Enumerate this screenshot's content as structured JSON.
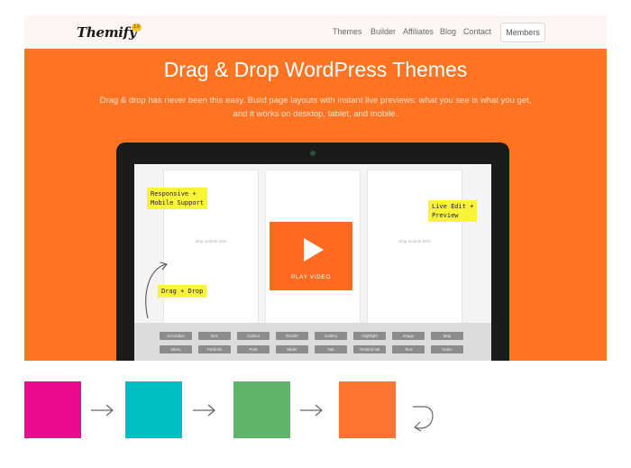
{
  "header": {
    "logo": "Themify",
    "logo_badge": "2.0",
    "nav": [
      "Themes",
      "Builder",
      "Affiliates",
      "Blog",
      "Contact"
    ],
    "members_label": "Members"
  },
  "hero": {
    "title": "Drag & Drop WordPress Themes",
    "subtitle": "Drag & drop has never been this easy. Build page layouts with instant live previews: what you see is what you get, and it works on desktop, tablet, and mobile."
  },
  "builder": {
    "drop_hint": "drop module here",
    "video_label": "PLAY VIDEO",
    "notes": {
      "responsive": [
        "Responsive +",
        "Mobile Support"
      ],
      "live_edit": [
        "Live Edit +",
        "Preview"
      ],
      "drag_drop": [
        "Drag + Drop"
      ]
    },
    "modules_row1": [
      "Accordion",
      "Box",
      "Callout",
      "Divider",
      "Gallery",
      "Highlight",
      "Image",
      "Map"
    ],
    "modules_row2": [
      "Menu",
      "Portfolio",
      "Post",
      "Slider",
      "Tab",
      "Testimonial",
      "Text",
      "Video"
    ]
  },
  "colors": {
    "accent": "#ff7422",
    "swatches": [
      "#ec0a8e",
      "#00bdc4",
      "#5fb46a",
      "#ff7431"
    ]
  },
  "icons": {
    "flow_arrow": "arrow-right-icon",
    "loop_arrow": "loop-back-icon",
    "play": "play-icon"
  }
}
